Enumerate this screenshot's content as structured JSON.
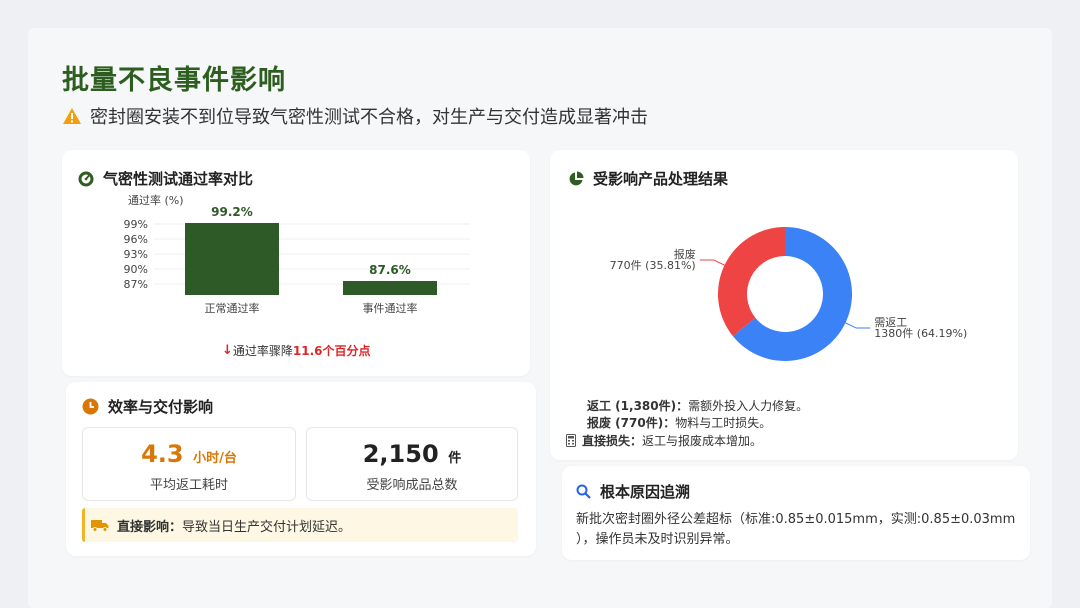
{
  "header": {
    "title": "批量不良事件影响",
    "subtitle": "密封圈安装不到位导致气密性测试不合格，对生产与交付造成显著冲击"
  },
  "pass_rate_card": {
    "title": "气密性测试通过率对比",
    "drop_prefix": "通过率骤降 ",
    "drop_value": "11.6个百分点"
  },
  "efficiency_card": {
    "title": "效率与交付影响",
    "kpi1_value": "4.3",
    "kpi1_unit": "小时/台",
    "kpi1_label": "平均返工耗时",
    "kpi2_value": "2,150",
    "kpi2_unit": "件",
    "kpi2_label": "受影响成品总数",
    "impact_label": "直接影响：",
    "impact_text": "导致当日生产交付计划延迟。"
  },
  "disposal_card": {
    "title": "受影响产品处理结果",
    "line1_label": "返工 (1,380件)：",
    "line1_text": "需额外投入人力修复。",
    "line2_label": "报废 (770件)：",
    "line2_text": "物料与工时损失。",
    "line3_label": "直接损失：",
    "line3_text": "返工与报废成本增加。"
  },
  "root_cause_card": {
    "title": "根本原因追溯",
    "text_line1": "新批次密封圈外径公差超标（标准:0.85±0.015mm，实测:0.85±0.03mm",
    "text_line2": "），操作员未及时识别异常。"
  },
  "colors": {
    "brand_green": "#2e5e1f",
    "bar_green": "#2d5a27",
    "rework_blue": "#3b82f6",
    "scrap_red": "#ef4444",
    "accent_orange": "#d97706",
    "drop_red": "#dc2626"
  },
  "chart_data": [
    {
      "type": "bar",
      "title": "",
      "ylabel": "通过率 (%)",
      "categories": [
        "正常通过率",
        "事件通过率"
      ],
      "values": [
        99.2,
        87.6
      ],
      "value_labels": [
        "99.2%",
        "87.6%"
      ],
      "yticks": [
        "99%",
        "96%",
        "93%",
        "90%",
        "87%"
      ],
      "ylim": [
        85,
        100
      ]
    },
    {
      "type": "pie",
      "subtype": "donut",
      "slices": [
        {
          "name": "需返工",
          "value": 1380,
          "label": "1380件 (64.19%)"
        },
        {
          "name": "报废",
          "value": 770,
          "label": "770件 (35.81%)"
        }
      ]
    }
  ]
}
